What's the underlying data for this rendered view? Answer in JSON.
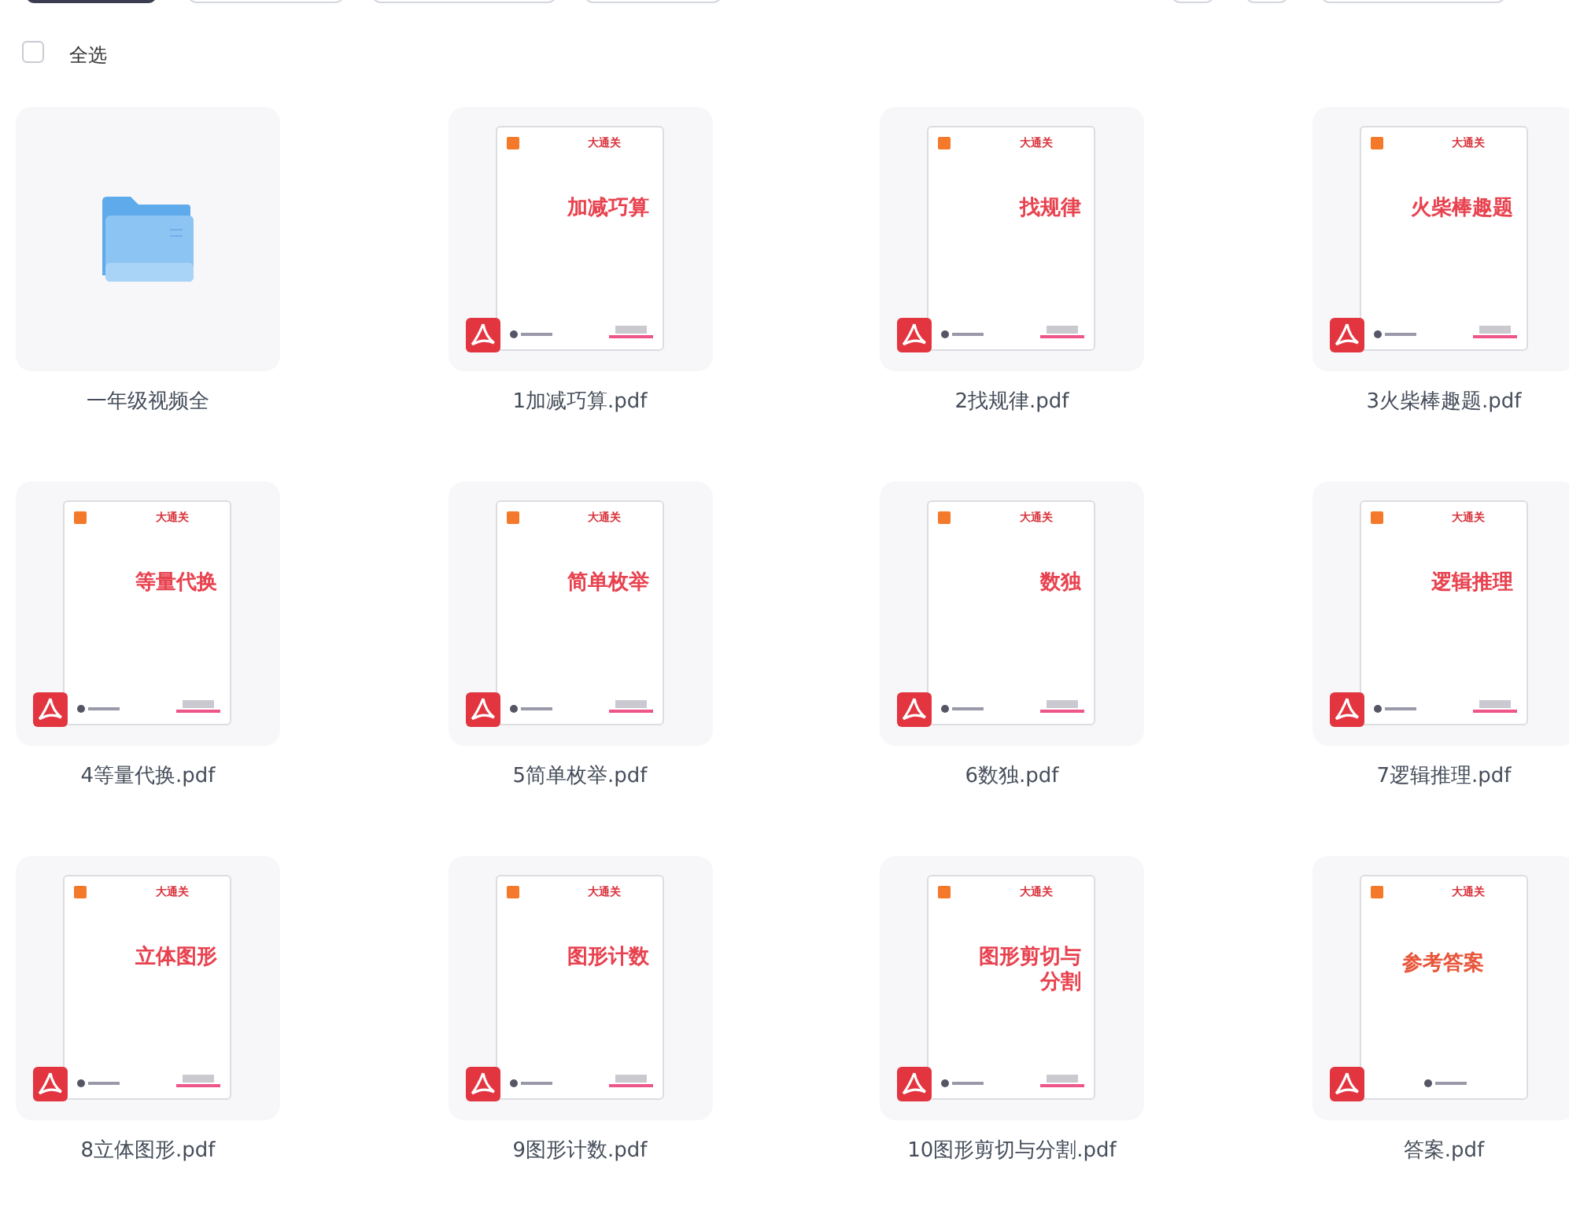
{
  "toolbar": {
    "buttons": [
      {
        "primary": true
      },
      {
        "primary": false
      },
      {
        "primary": false
      },
      {
        "primary": false
      }
    ],
    "right_buttons": [
      {
        "wide": false
      },
      {
        "wide": false
      },
      {
        "wide": true
      }
    ]
  },
  "select_all": {
    "label": "全选",
    "checked": false
  },
  "items": [
    {
      "kind": "folder",
      "name": "一年级视频全"
    },
    {
      "kind": "pdf",
      "name": "1加减巧算.pdf",
      "cover": {
        "brand": "大通关",
        "title": "加减巧算",
        "centered": false
      }
    },
    {
      "kind": "pdf",
      "name": "2找规律.pdf",
      "cover": {
        "brand": "大通关",
        "title": "找规律",
        "centered": false
      }
    },
    {
      "kind": "pdf",
      "name": "3火柴棒趣题.pdf",
      "cover": {
        "brand": "大通关",
        "title": "火柴棒趣题",
        "centered": false
      }
    },
    {
      "kind": "pdf",
      "name": "4等量代换.pdf",
      "cover": {
        "brand": "大通关",
        "title": "等量代换",
        "centered": false
      }
    },
    {
      "kind": "pdf",
      "name": "5简单枚举.pdf",
      "cover": {
        "brand": "大通关",
        "title": "简单枚举",
        "centered": false
      }
    },
    {
      "kind": "pdf",
      "name": "6数独.pdf",
      "cover": {
        "brand": "大通关",
        "title": "数独",
        "centered": false
      }
    },
    {
      "kind": "pdf",
      "name": "7逻辑推理.pdf",
      "cover": {
        "brand": "大通关",
        "title": "逻辑推理",
        "centered": false
      }
    },
    {
      "kind": "pdf",
      "name": "8立体图形.pdf",
      "cover": {
        "brand": "大通关",
        "title": "立体图形",
        "centered": false
      }
    },
    {
      "kind": "pdf",
      "name": "9图形计数.pdf",
      "cover": {
        "brand": "大通关",
        "title": "图形计数",
        "centered": false
      }
    },
    {
      "kind": "pdf",
      "name": "10图形剪切与分割.pdf",
      "cover": {
        "brand": "大通关",
        "title": "图形剪切与分割",
        "centered": false
      }
    },
    {
      "kind": "pdf",
      "name": "答案.pdf",
      "cover": {
        "brand": "大通关",
        "title": "参考答案",
        "centered": true
      }
    }
  ]
}
